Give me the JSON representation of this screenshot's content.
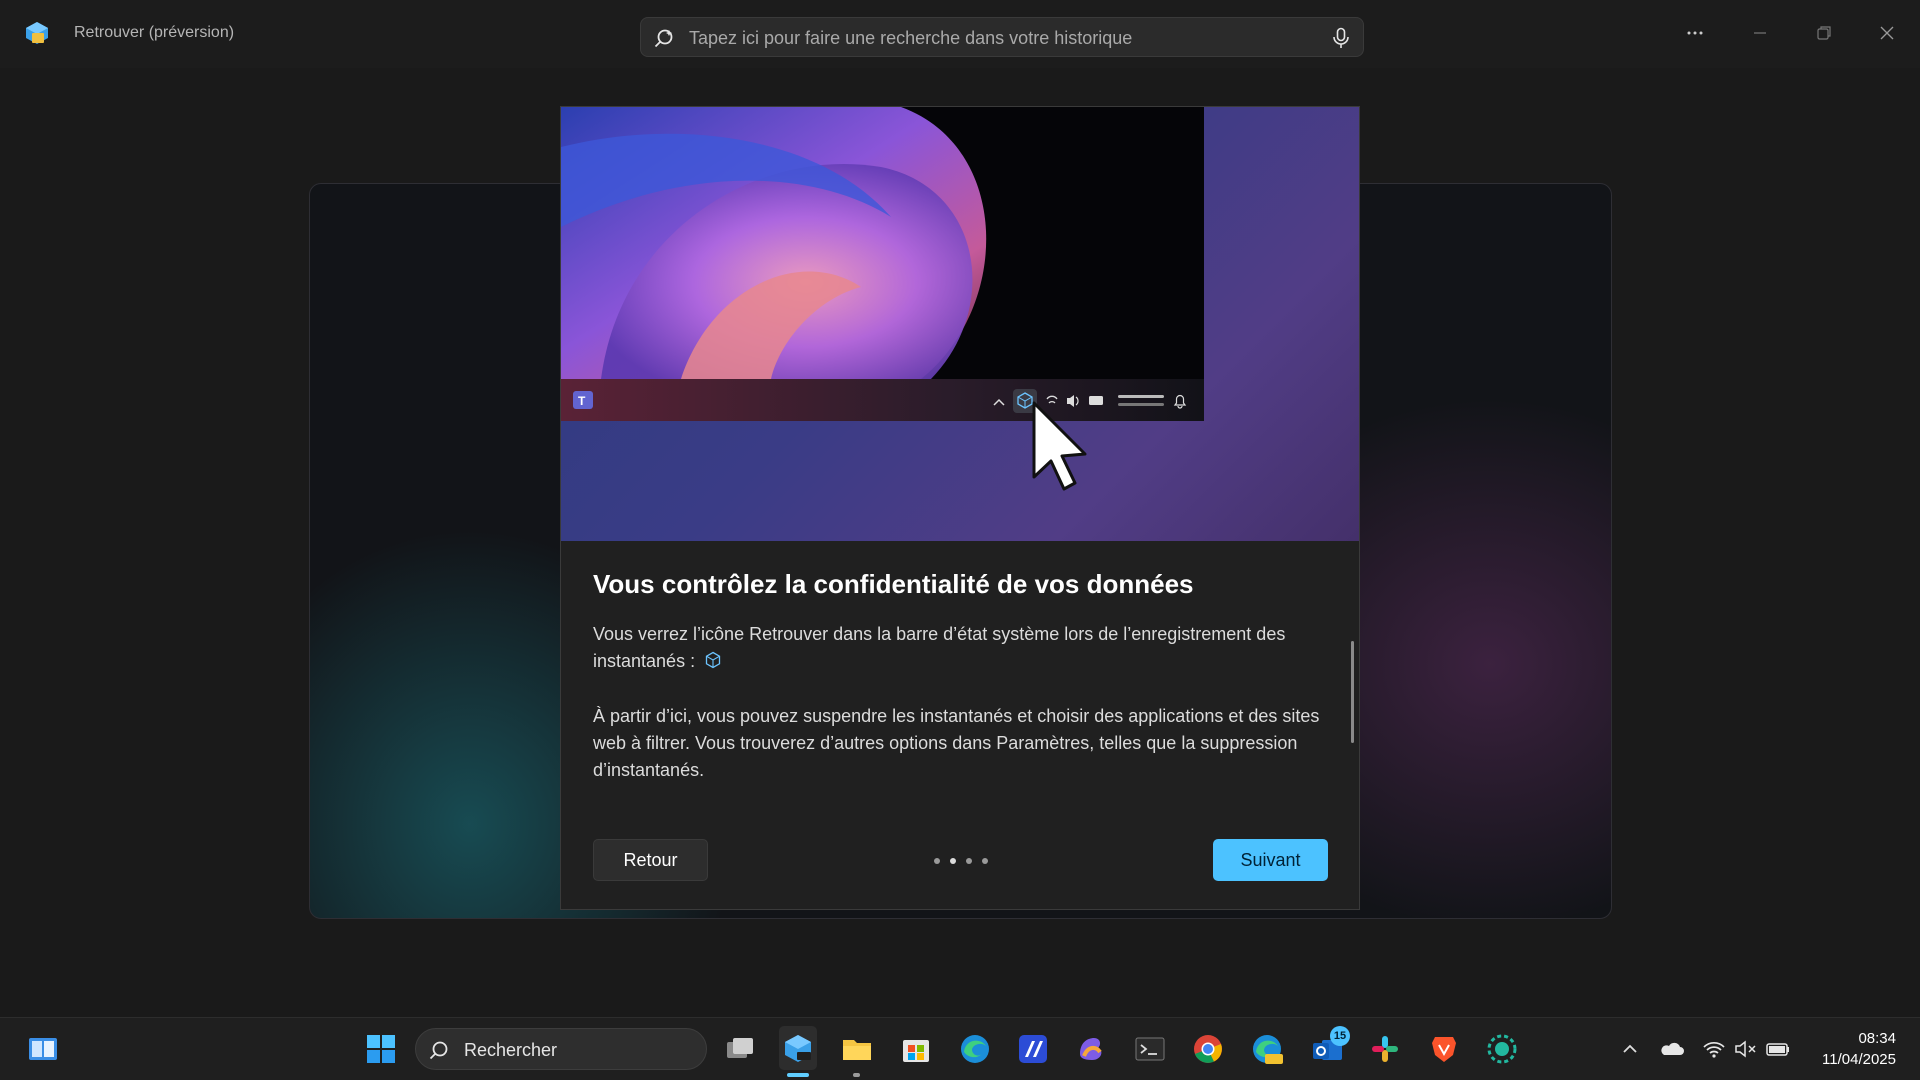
{
  "app": {
    "title": "Retrouver (préversion)",
    "search_placeholder": "Tapez ici pour faire une recherche dans votre historique"
  },
  "dialog": {
    "title": "Vous contrôlez la confidentialité de vos données",
    "paragraph1": "Vous verrez l’icône Retrouver dans la barre d’état système lors de l’enregistrement des instantanés :",
    "paragraph2": "À partir d’ici, vous pouvez suspendre les instantanés et choisir des applications et des sites web à filtrer. Vous trouverez d’autres options dans Paramètres, telles que la suppression d’instantanés.",
    "back_label": "Retour",
    "next_label": "Suivant",
    "pager_count": 4,
    "pager_current": 2
  },
  "taskbar": {
    "search_label": "Rechercher",
    "mail_badge": "15",
    "time": "08:34",
    "date": "11/04/2025"
  },
  "colors": {
    "accent": "#4cc2ff",
    "background": "#1a1a1a",
    "dialog_bg": "#202020"
  },
  "icons": [
    "recall-app-icon",
    "search-icon",
    "microphone-icon",
    "more-options-icon",
    "minimize-icon",
    "maximize-icon",
    "close-icon",
    "teams-icon",
    "recall-tray-icon",
    "mouse-cursor-icon",
    "windows-start-icon",
    "task-view-icon",
    "recall-taskbar-icon",
    "file-explorer-icon",
    "microsoft-store-icon",
    "edge-icon",
    "app-icon",
    "copilot-icon",
    "terminal-icon",
    "chrome-icon",
    "edge-canary-icon",
    "outlook-icon",
    "slack-icon",
    "brave-icon",
    "screen-recorder-icon",
    "chevron-up-icon",
    "onedrive-icon",
    "wifi-icon",
    "speaker-muted-icon",
    "battery-icon"
  ]
}
